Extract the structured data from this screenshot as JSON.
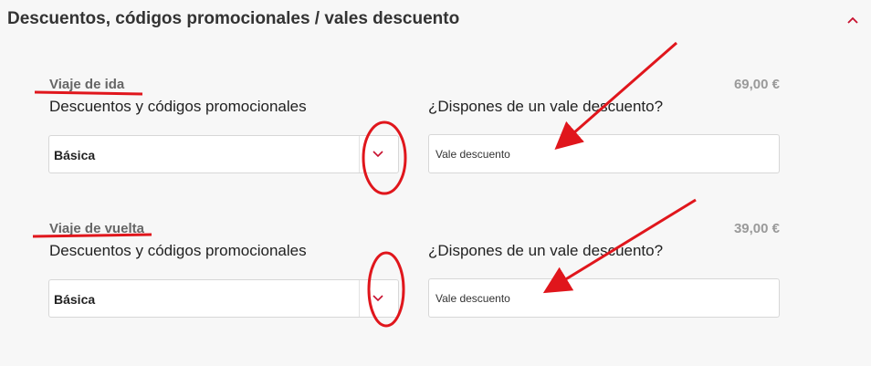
{
  "header": {
    "title": "Descuentos, códigos promocionales / vales descuento",
    "collapse_icon": "chevron-up-icon"
  },
  "trips": [
    {
      "title": "Viaje de ida",
      "price": "69,00 €",
      "discount_label": "Descuentos y códigos promocionales",
      "discount_value": "Básica",
      "voucher_label": "¿Dispones de un vale descuento?",
      "voucher_placeholder": "Vale descuento"
    },
    {
      "title": "Viaje de vuelta",
      "price": "39,00 €",
      "discount_label": "Descuentos y códigos promocionales",
      "discount_value": "Básica",
      "voucher_label": "¿Dispones de un vale descuento?",
      "voucher_placeholder": "Vale descuento"
    }
  ],
  "colors": {
    "accent": "#c8102e",
    "annotation": "#e0161c"
  }
}
